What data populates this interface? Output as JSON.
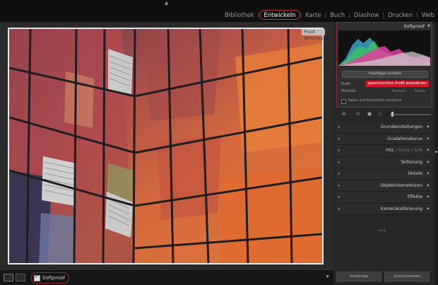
{
  "topbar": {
    "modules": [
      {
        "label": "Bibliothek",
        "active": false
      },
      {
        "label": "Entwickeln",
        "active": true
      },
      {
        "label": "Karte",
        "active": false
      },
      {
        "label": "Buch",
        "active": false
      },
      {
        "label": "Diashow",
        "active": false
      },
      {
        "label": "Drucken",
        "active": false
      },
      {
        "label": "Web",
        "active": false
      }
    ]
  },
  "preview": {
    "proof_label": "Proof-Vorschau"
  },
  "softproof_panel": {
    "title": "Softproof",
    "histogram_info": [
      "ISO 250",
      "24,4 mm",
      "f / 4,0",
      "1/30 Sek."
    ],
    "copy_button": "Proof-Kopie erstellen",
    "profile_label": "Profil:",
    "profile_value": "gewünschtes Profil auswählen",
    "priority_label": "Priorität:",
    "priority_options": [
      "Perzeptiv",
      "Relativ"
    ],
    "simulate_label": "Papier und Druckfarbe simulieren"
  },
  "sections": [
    {
      "label": "Grundeinstellungen"
    },
    {
      "label": "Gradationskurve"
    },
    {
      "label": "HSL",
      "extra": [
        "Farbe",
        "S/W"
      ]
    },
    {
      "label": "Teiltonung"
    },
    {
      "label": "Details"
    },
    {
      "label": "Objektivkorrekturen"
    },
    {
      "label": "Effekte"
    },
    {
      "label": "Kamerakalibrierung"
    }
  ],
  "bottom": {
    "softproof_label": "Softproof",
    "softproof_checked": true,
    "prev_button": "Vorherige",
    "reset_button": "Zurücksetzen"
  },
  "colors": {
    "accent": "#c0323a",
    "profile_bg": "#d4142a"
  }
}
